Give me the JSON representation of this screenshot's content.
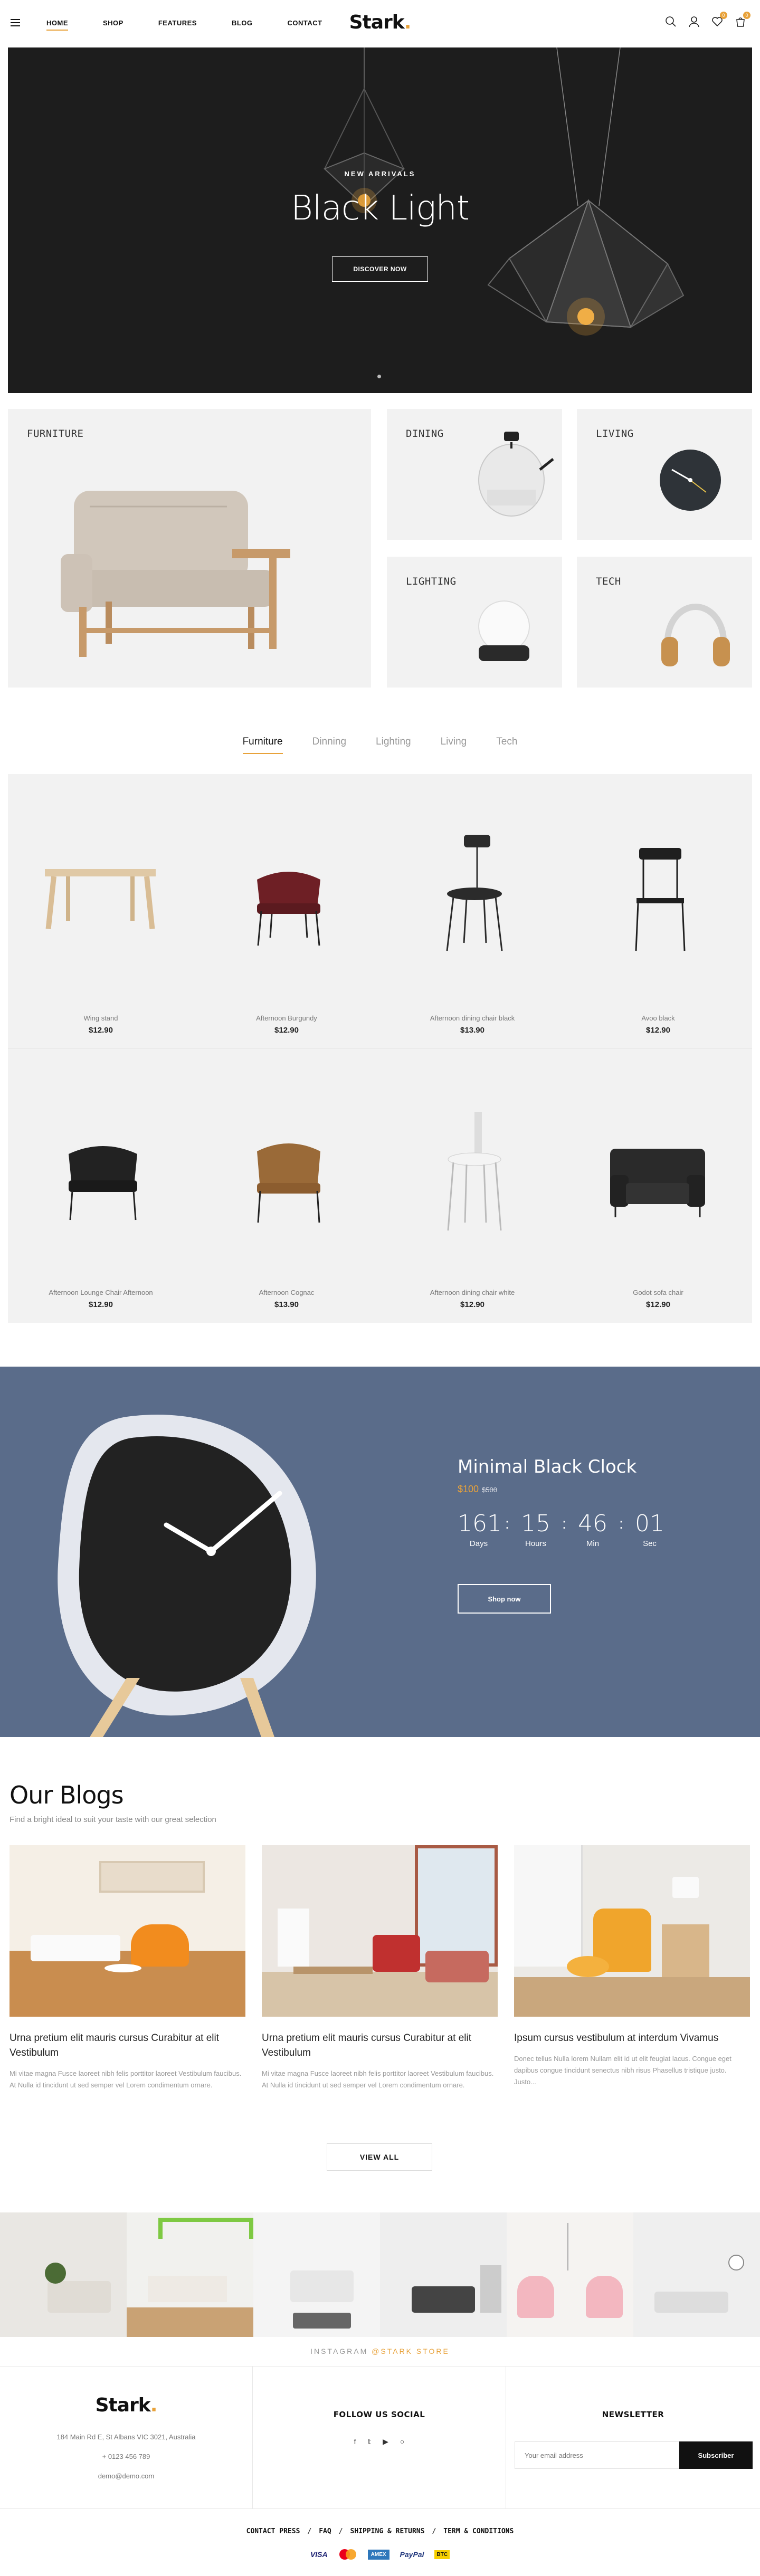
{
  "header": {
    "nav": [
      "HOME",
      "SHOP",
      "FEATURES",
      "BLOG",
      "CONTACT"
    ],
    "logo_text": "Stark",
    "logo_dot": ".",
    "wishlist_count": "0",
    "cart_count": "0",
    "accent_color": "#e8a23a"
  },
  "hero": {
    "subtitle": "NEW ARRIVALS",
    "title": "Black Light",
    "button": "DISCOVER NOW"
  },
  "categories": {
    "furniture": "FURNITURE",
    "dining": "DINING",
    "living": "LIVING",
    "lighting": "LIGHTING",
    "tech": "TECH"
  },
  "tabs": [
    "Furniture",
    "Dinning",
    "Lighting",
    "Living",
    "Tech"
  ],
  "products": [
    {
      "name": "Wing stand",
      "price": "$12.90"
    },
    {
      "name": "Afternoon Burgundy",
      "price": "$12.90"
    },
    {
      "name": "Afternoon dining chair black",
      "price": "$13.90"
    },
    {
      "name": "Avoo black",
      "price": "$12.90"
    },
    {
      "name": "Afternoon Lounge Chair Afternoon",
      "price": "$12.90"
    },
    {
      "name": "Afternoon Cognac",
      "price": "$13.90"
    },
    {
      "name": "Afternoon dining chair white",
      "price": "$12.90"
    },
    {
      "name": "Godot sofa chair",
      "price": "$12.90"
    }
  ],
  "deal": {
    "title": "Minimal Black Clock",
    "price": "$100",
    "old_price": "$500",
    "days": "161",
    "days_label": "Days",
    "hours": "15",
    "hours_label": "Hours",
    "mins": "46",
    "mins_label": "Min",
    "secs": "01",
    "secs_label": "Sec",
    "button": "Shop now"
  },
  "blogs": {
    "heading": "Our Blogs",
    "subheading": "Find a bright ideal to suit your taste with our great selection",
    "posts": [
      {
        "title": "Urna pretium elit mauris cursus Curabitur at elit Vestibulum",
        "text": "Mi vitae magna Fusce laoreet nibh felis porttitor laoreet Vestibulum faucibus. At Nulla id tincidunt ut sed semper vel Lorem condimentum ornare."
      },
      {
        "title": "Urna pretium elit mauris cursus Curabitur at elit Vestibulum",
        "text": "Mi vitae magna Fusce laoreet nibh felis porttitor laoreet Vestibulum faucibus. At Nulla id tincidunt ut sed semper vel Lorem condimentum ornare."
      },
      {
        "title": "Ipsum cursus vestibulum at interdum Vivamus",
        "text": "Donec tellus Nulla lorem Nullam elit id ut elit feugiat lacus. Congue eget dapibus congue tincidunt senectus nibh risus Phasellus tristique justo. Justo..."
      }
    ],
    "view_all": "VIEW ALL"
  },
  "instagram": {
    "caption_prefix": "INSTAGRAM ",
    "caption_handle": "@STARK STORE"
  },
  "footer": {
    "logo_text": "Stark",
    "address": "184 Main Rd E, St Albans VIC 3021, Australia",
    "phone": "+ 0123 456 789",
    "email": "demo@demo.com",
    "follow_heading": "FOLLOW US SOCIAL",
    "newsletter_heading": "NEWSLETTER",
    "newsletter_placeholder": "Your email address",
    "subscribe": "Subscriber",
    "links": [
      "CONTACT PRESS",
      "FAQ",
      "SHIPPING & RETURNS",
      "TERM & CONDITIONS"
    ],
    "link_sep": "/",
    "payments": [
      "VISA",
      "MasterCard",
      "AMEX",
      "PayPal",
      "BTC"
    ]
  }
}
